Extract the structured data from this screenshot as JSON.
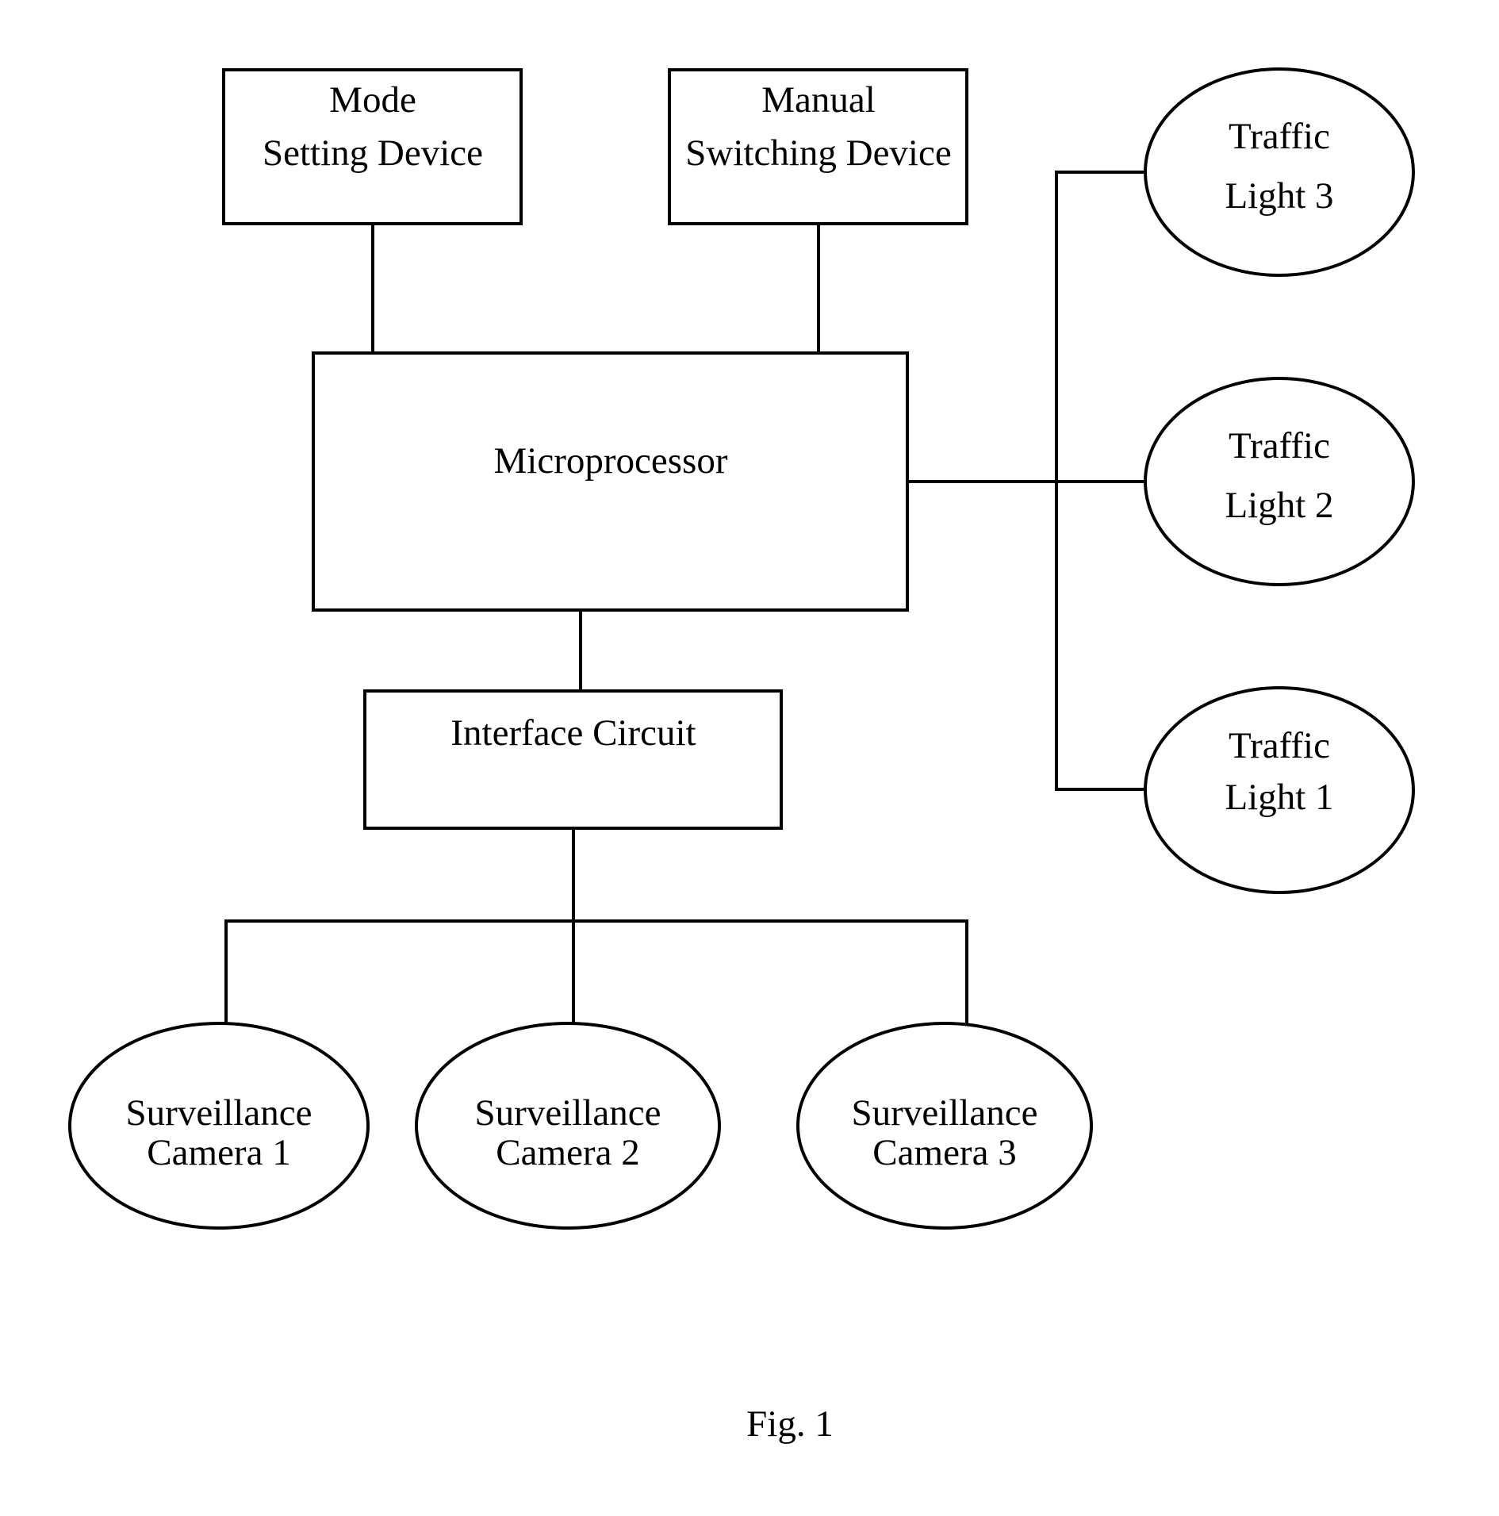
{
  "figure": {
    "caption": "Fig. 1",
    "colors": {
      "line": "#000000",
      "background": "#ffffff"
    }
  },
  "nodes": {
    "mode_setting_device": {
      "lines": [
        "Mode",
        "Setting Device"
      ],
      "shape": "rectangle"
    },
    "manual_switching_device": {
      "lines": [
        "Manual",
        "Switching Device"
      ],
      "shape": "rectangle"
    },
    "microprocessor": {
      "lines": [
        "Microprocessor"
      ],
      "shape": "rectangle"
    },
    "interface_circuit": {
      "lines": [
        "Interface Circuit"
      ],
      "shape": "rectangle"
    },
    "traffic_light_3": {
      "lines": [
        "Traffic",
        "Light 3"
      ],
      "shape": "ellipse"
    },
    "traffic_light_2": {
      "lines": [
        "Traffic",
        "Light 2"
      ],
      "shape": "ellipse"
    },
    "traffic_light_1": {
      "lines": [
        "Traffic",
        "Light 1"
      ],
      "shape": "ellipse"
    },
    "surveillance_camera_1": {
      "lines": [
        "Surveillance",
        "Camera 1"
      ],
      "shape": "ellipse"
    },
    "surveillance_camera_2": {
      "lines": [
        "Surveillance",
        "Camera 2"
      ],
      "shape": "ellipse"
    },
    "surveillance_camera_3": {
      "lines": [
        "Surveillance",
        "Camera 3"
      ],
      "shape": "ellipse"
    }
  },
  "edges": [
    {
      "from": "mode_setting_device",
      "to": "microprocessor"
    },
    {
      "from": "manual_switching_device",
      "to": "microprocessor"
    },
    {
      "from": "microprocessor",
      "to": "traffic_light_1"
    },
    {
      "from": "microprocessor",
      "to": "traffic_light_2"
    },
    {
      "from": "microprocessor",
      "to": "traffic_light_3"
    },
    {
      "from": "microprocessor",
      "to": "interface_circuit"
    },
    {
      "from": "interface_circuit",
      "to": "surveillance_camera_1"
    },
    {
      "from": "interface_circuit",
      "to": "surveillance_camera_2"
    },
    {
      "from": "interface_circuit",
      "to": "surveillance_camera_3"
    }
  ]
}
